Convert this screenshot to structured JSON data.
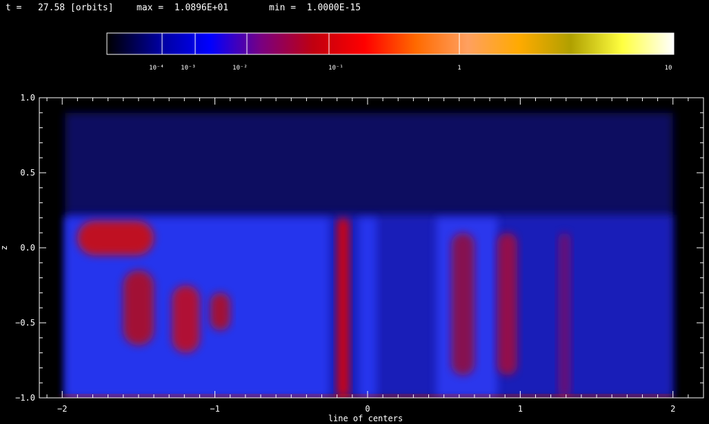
{
  "header": {
    "time": "t =   27.58 [orbits]",
    "max": "max =  1.0896E+01",
    "min": "min =  1.0000E-15"
  },
  "colorbar": {
    "scale": "log",
    "labels": [
      "10⁻⁴",
      "10⁻³",
      "10⁻²",
      "10⁻¹",
      "1",
      "10"
    ],
    "colors": [
      "#000000",
      "#00009a",
      "#0000ff",
      "#7a0080",
      "#c00010",
      "#ff0000",
      "#ff6a00",
      "#ffa060",
      "#ffaa00",
      "#b0a000",
      "#ffff40",
      "#ffffff"
    ]
  },
  "chart_data": {
    "type": "heatmap",
    "xlabel": "line of centers",
    "ylabel": "z",
    "xlim": [
      -2.15,
      2.2
    ],
    "ylim": [
      -1.0,
      1.0
    ],
    "xticks": [
      -2,
      -1,
      0,
      1,
      2
    ],
    "yticks": [
      1.0,
      0.5,
      0.0,
      -0.5,
      -1.0
    ],
    "xtick_labels": [
      "−2",
      "−1",
      "0",
      "1",
      "2"
    ],
    "ytick_labels": [
      "1.0",
      "0.5",
      "0.0",
      "−0.5",
      "−1.0"
    ],
    "background_color": "#0a0a60",
    "features": [
      {
        "kind": "band",
        "x": [
          -1.9,
          -1.4
        ],
        "y": [
          -0.05,
          0.18
        ],
        "level": 0.12,
        "color": "#d01010"
      },
      {
        "kind": "band",
        "x": [
          -1.6,
          -1.4
        ],
        "y": [
          -0.65,
          -0.15
        ],
        "level": 0.06,
        "color": "#b01020"
      },
      {
        "kind": "band",
        "x": [
          -1.28,
          -1.1
        ],
        "y": [
          -0.7,
          -0.25
        ],
        "level": 0.06,
        "color": "#c01020"
      },
      {
        "kind": "band",
        "x": [
          -1.03,
          -0.9
        ],
        "y": [
          -0.55,
          -0.3
        ],
        "level": 0.05,
        "color": "#b01020"
      },
      {
        "kind": "band",
        "x": [
          -0.2,
          -0.12
        ],
        "y": [
          -1.0,
          0.2
        ],
        "level": 0.2,
        "color": "#e00000"
      },
      {
        "kind": "band",
        "x": [
          0.55,
          0.7
        ],
        "y": [
          -0.85,
          0.1
        ],
        "level": 0.05,
        "color": "#901040"
      },
      {
        "kind": "band",
        "x": [
          0.85,
          0.98
        ],
        "y": [
          -0.85,
          0.1
        ],
        "level": 0.05,
        "color": "#a01040"
      },
      {
        "kind": "band",
        "x": [
          1.25,
          1.33
        ],
        "y": [
          -1.0,
          0.1
        ],
        "level": 0.02,
        "color": "#701070"
      },
      {
        "kind": "band",
        "x": [
          -2.0,
          2.0
        ],
        "y": [
          -1.0,
          -0.98
        ],
        "level": 1.0,
        "color": "#ff2000"
      }
    ]
  }
}
